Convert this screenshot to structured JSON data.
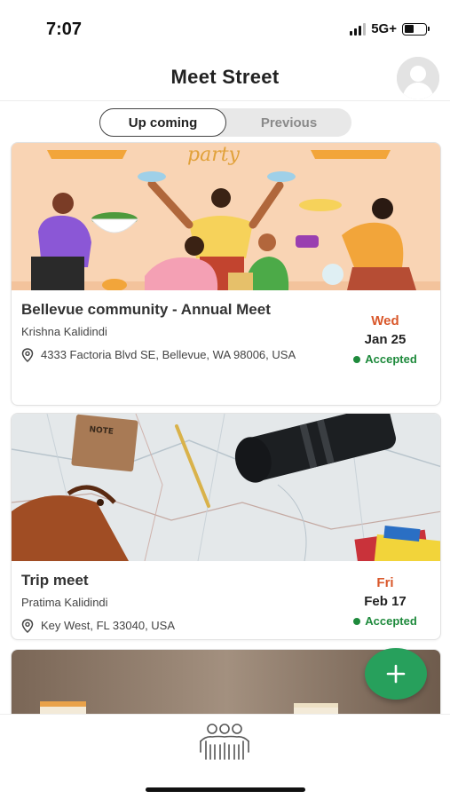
{
  "status_bar": {
    "time": "7:07",
    "network": "5G+"
  },
  "header": {
    "title": "Meet Street",
    "avatar_icon": "user-avatar-icon"
  },
  "tabs": [
    {
      "label": "Up coming",
      "active": true
    },
    {
      "label": "Previous",
      "active": false
    }
  ],
  "events": [
    {
      "title": "Bellevue community - Annual Meet",
      "host": "Krishna Kalidindi",
      "location": "4333 Factoria Blvd SE, Bellevue, WA 98006, USA",
      "day": "Wed",
      "date": "Jan 25",
      "status": "Accepted",
      "image_text": "party"
    },
    {
      "title": "Trip meet",
      "host": "Pratima Kalidindi",
      "location": "Key West, FL 33040, USA",
      "day": "Fri",
      "date": "Feb 17",
      "status": "Accepted",
      "image_text": "NOTE"
    }
  ],
  "fab": {
    "icon": "plus-icon"
  },
  "bottom_nav": {
    "icon": "people-group-icon"
  },
  "colors": {
    "accent_green": "#27a05c",
    "status_green": "#1e8a3c",
    "day_orange": "#d9582b",
    "party_bg": "#f9d4b4"
  }
}
